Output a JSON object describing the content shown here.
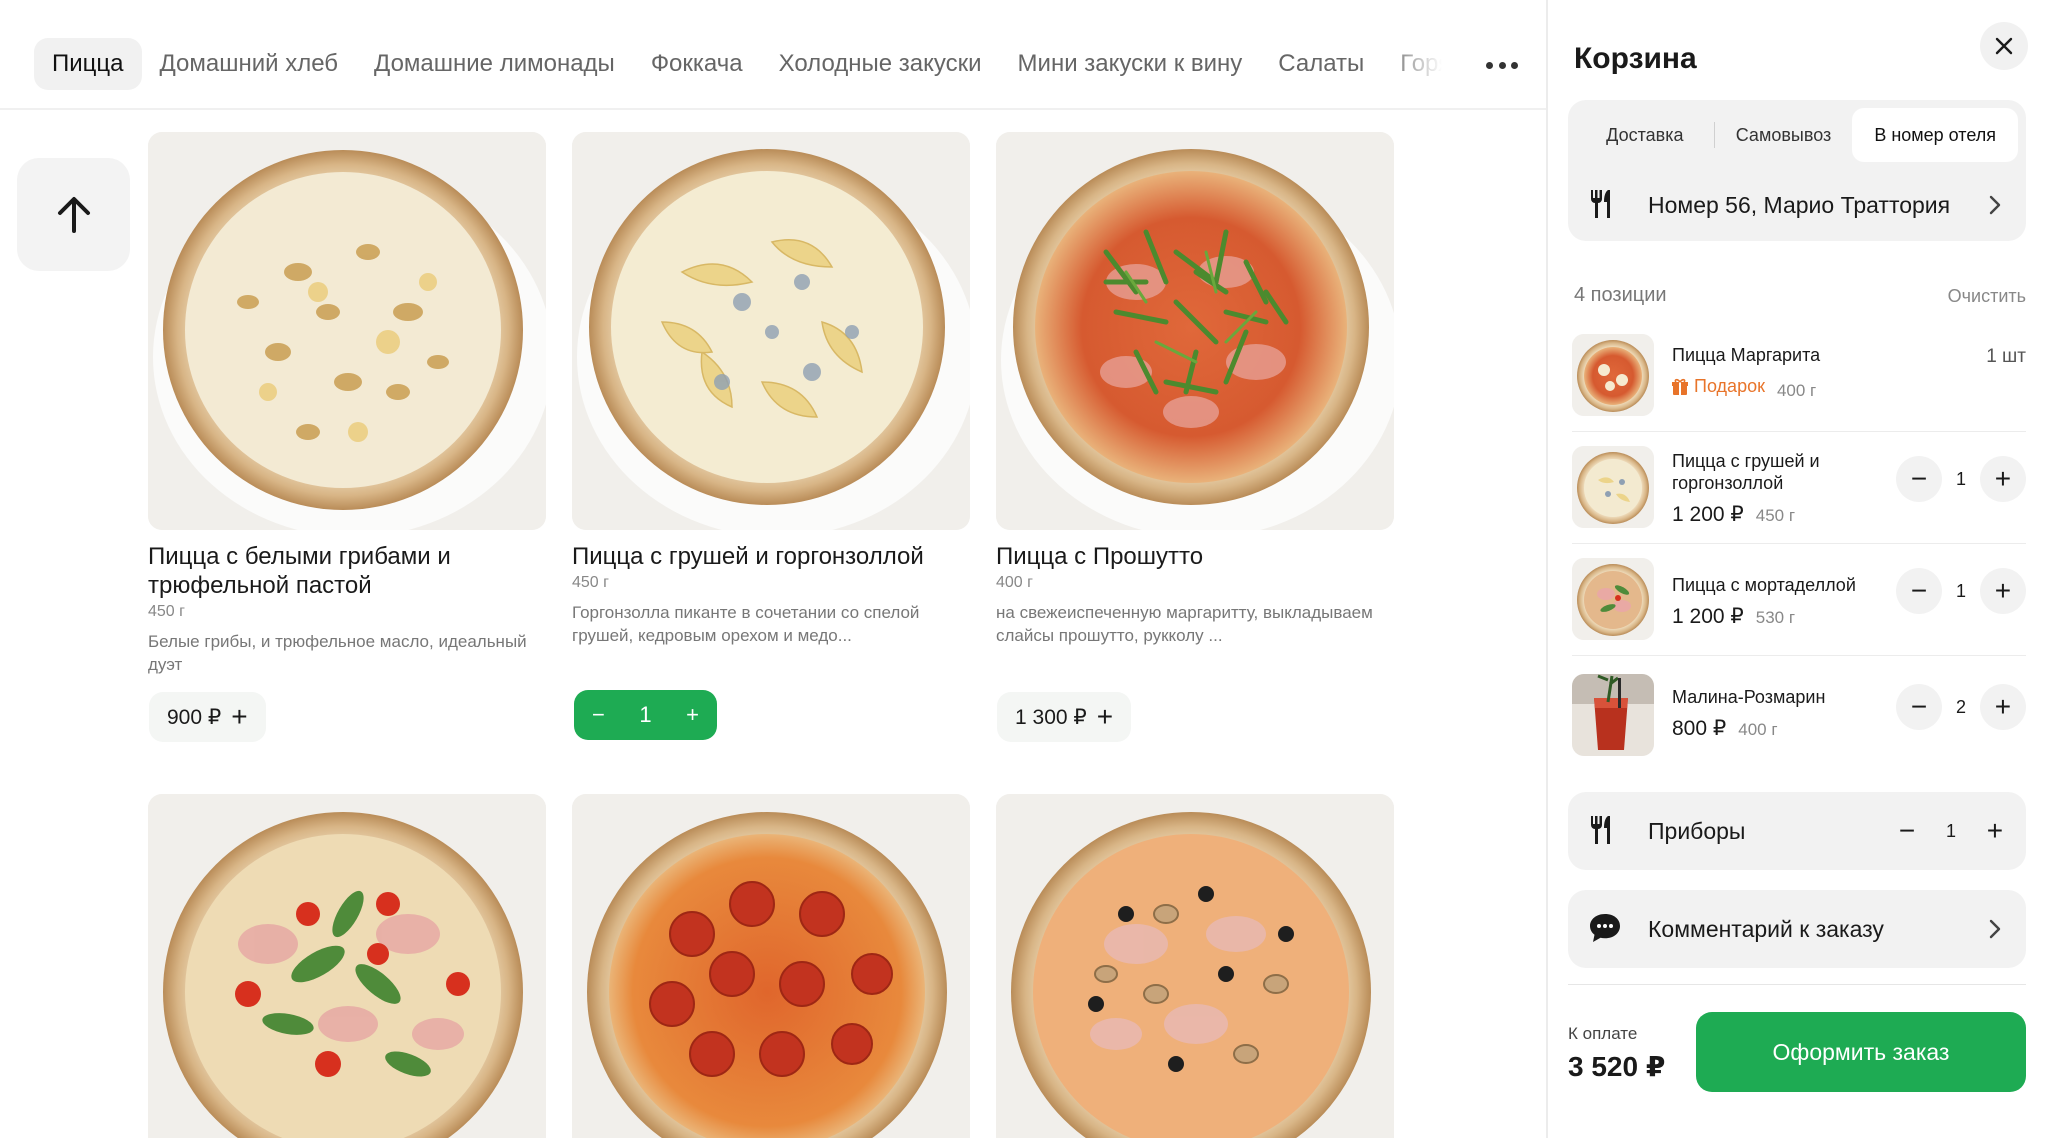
{
  "nav": {
    "tabs": [
      {
        "label": "Пицца",
        "active": true
      },
      {
        "label": "Домашний хлеб"
      },
      {
        "label": "Домашние лимонады"
      },
      {
        "label": "Фоккача"
      },
      {
        "label": "Холодные закуски"
      },
      {
        "label": "Мини закуски к вину"
      },
      {
        "label": "Салаты"
      },
      {
        "label": "Горя"
      }
    ]
  },
  "products": [
    {
      "title": "Пицца с белыми грибами и трюфельной пастой",
      "weight": "450 г",
      "desc": "Белые грибы, и трюфельное масло, идеальный дуэт",
      "price": "900 ₽"
    },
    {
      "title": "Пицца с грушей и горгонзоллой",
      "weight": "450 г",
      "desc": "Горгонзолла пиканте в сочетании со спелой грушей, кедровым орехом и медо...",
      "qty": "1"
    },
    {
      "title": "Пицца с Прошутто",
      "weight": "400 г",
      "desc": "на свежеиспеченную маргаритту, выкладываем слайсы прошутто, рукколу ...",
      "price": "1 300 ₽"
    }
  ],
  "cart": {
    "title": "Корзина",
    "modes": [
      "Доставка",
      "Самовывоз",
      "В номер отеля"
    ],
    "active_mode": "В номер отеля",
    "address": "Номер 56, Марио Траттория",
    "count": "4 позиции",
    "clear": "Очистить",
    "items": [
      {
        "name": "Пицца Маргарита",
        "gift": "Подарок",
        "weight": "400 г",
        "qty": "1 шт"
      },
      {
        "name": "Пицца с грушей и горгонзоллой",
        "price": "1 200 ₽",
        "weight": "450 г",
        "qty": "1"
      },
      {
        "name": "Пицца с мортаделлой",
        "price": "1 200 ₽",
        "weight": "530 г",
        "qty": "1"
      },
      {
        "name": "Малина-Розмарин",
        "price": "800 ₽",
        "weight": "400 г",
        "qty": "2"
      }
    ],
    "cutlery": {
      "label": "Приборы",
      "qty": "1"
    },
    "comment": "Комментарий к заказу",
    "pay_label": "К оплате",
    "total": "3 520 ₽",
    "checkout": "Оформить заказ"
  },
  "colors": {
    "accent": "#1eab53",
    "gift": "#e8742a"
  }
}
